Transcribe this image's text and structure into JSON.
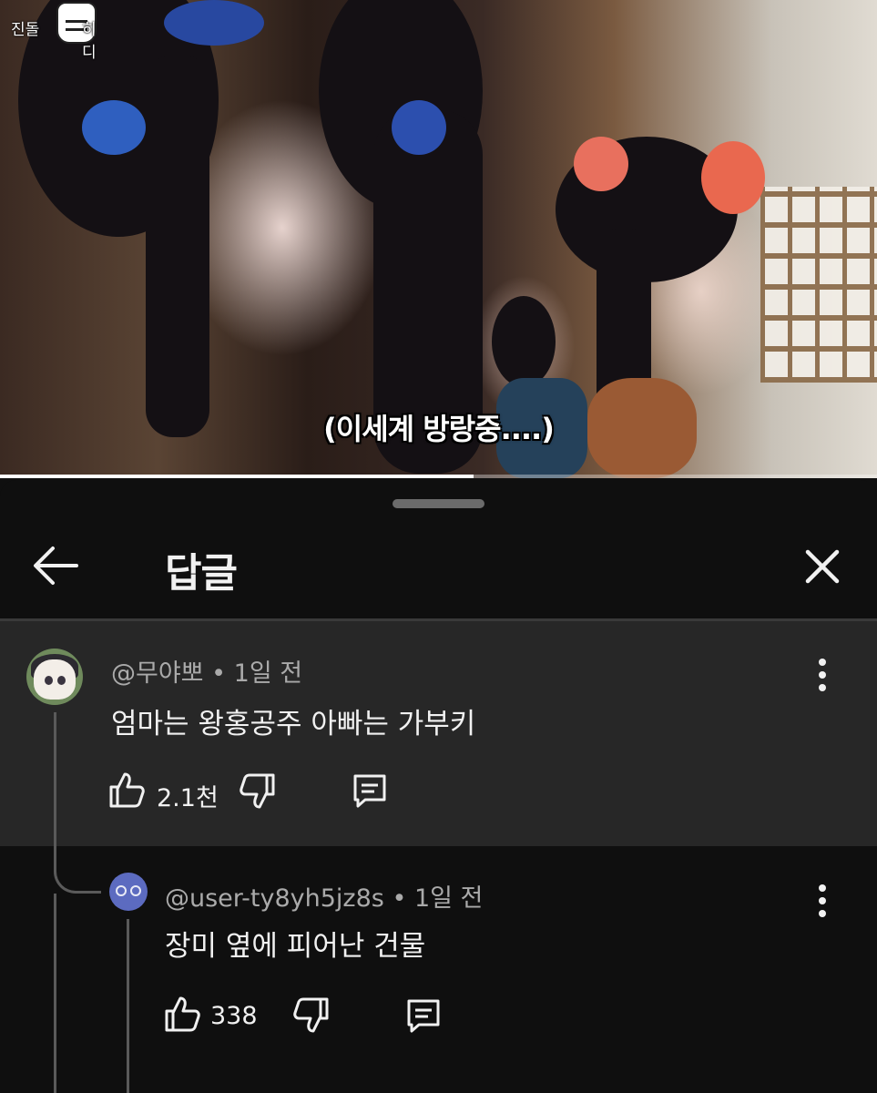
{
  "video": {
    "subtitle": "(이세계 방랑중....)",
    "watermark_left": "진돌",
    "watermark_right": "히디",
    "progress": 0.54
  },
  "sheet": {
    "title": "답글"
  },
  "parent_comment": {
    "handle": "@무야뽀",
    "time": "1일 전",
    "text": "엄마는 왕홍공주 아빠는 가부키",
    "likes": "2.1천"
  },
  "replies": [
    {
      "handle": "@user-ty8yh5jz8s",
      "time": "1일 전",
      "text": "장미 옆에 피어난 건물",
      "likes": "338"
    }
  ],
  "colors": {
    "background": "#0f0f0f",
    "highlight": "#272727",
    "text_primary": "#f1f1f1",
    "text_secondary": "#aaaaaa",
    "reply_avatar": "#5c6bc0"
  },
  "icons": [
    "back-arrow-icon",
    "close-icon",
    "more-vert-icon",
    "thumb-up-icon",
    "thumb-down-icon",
    "reply-comment-icon"
  ]
}
